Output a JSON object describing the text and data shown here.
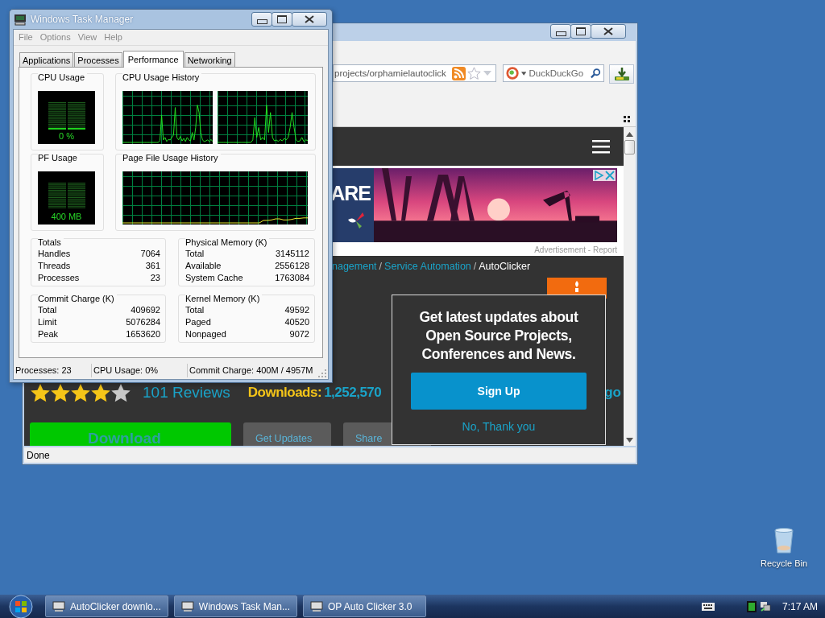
{
  "task_manager": {
    "title": "Windows Task Manager",
    "menu": [
      "File",
      "Options",
      "View",
      "Help"
    ],
    "tabs": [
      {
        "label": "Applications",
        "selected": false
      },
      {
        "label": "Processes",
        "selected": false
      },
      {
        "label": "Performance",
        "selected": true
      },
      {
        "label": "Networking",
        "selected": false
      }
    ],
    "cpu_usage": {
      "title": "CPU Usage",
      "reading": "0 %"
    },
    "cpu_history": {
      "title": "CPU Usage History"
    },
    "pf_usage": {
      "title": "PF Usage",
      "reading": "400 MB"
    },
    "pf_history": {
      "title": "Page File Usage History"
    },
    "groups": [
      {
        "title": "Totals",
        "rows": [
          {
            "label": "Handles",
            "value": "7064"
          },
          {
            "label": "Threads",
            "value": "361"
          },
          {
            "label": "Processes",
            "value": "23"
          }
        ]
      },
      {
        "title": "Physical Memory (K)",
        "rows": [
          {
            "label": "Total",
            "value": "3145112"
          },
          {
            "label": "Available",
            "value": "2556128"
          },
          {
            "label": "System Cache",
            "value": "1763084"
          }
        ]
      },
      {
        "title": "Commit Charge (K)",
        "rows": [
          {
            "label": "Total",
            "value": "409692"
          },
          {
            "label": "Limit",
            "value": "5076284"
          },
          {
            "label": "Peak",
            "value": "1653620"
          }
        ]
      },
      {
        "title": "Kernel Memory (K)",
        "rows": [
          {
            "label": "Total",
            "value": "49592"
          },
          {
            "label": "Paged",
            "value": "40520"
          },
          {
            "label": "Nonpaged",
            "value": "9072"
          }
        ]
      }
    ],
    "status_bar": [
      "Processes: 23",
      "CPU Usage: 0%",
      "Commit Charge: 400M / 4957M"
    ]
  },
  "browser": {
    "address": "projects/orphamielautoclick",
    "search_placeholder": "DuckDuckGo",
    "ad": {
      "headline": "ARE",
      "caption": "Advertisement - Report"
    },
    "breadcrumb": [
      {
        "text": "nagement",
        "kind": "link"
      },
      {
        "text": "Service Automation",
        "kind": "link"
      },
      {
        "text": "AutoClicker",
        "kind": "current"
      }
    ],
    "separator": "/",
    "stars": 4,
    "reviews": "101 Reviews",
    "downloads_label": "Downloads:",
    "downloads_value": "1,252,570",
    "trailing_link": "go",
    "buttons": [
      {
        "label": "Download",
        "kind": "primary"
      },
      {
        "label": "Get Updates",
        "kind": "secondary"
      },
      {
        "label": "Share",
        "kind": "secondary"
      }
    ],
    "popup": {
      "heading": "Get latest updates about Open Source Projects, Conferences and News.",
      "primary": "Sign Up",
      "secondary": "No, Thank you"
    },
    "status": "Done"
  },
  "desktop_icons": [
    {
      "label": "Recycle Bin"
    }
  ],
  "taskbar": {
    "tasks": [
      {
        "label": "AutoClicker downlo...",
        "selected": false
      },
      {
        "label": "Windows Task Man...",
        "selected": false
      },
      {
        "label": "OP Auto Clicker 3.0",
        "selected": false
      }
    ],
    "clock": "7:17 AM"
  }
}
